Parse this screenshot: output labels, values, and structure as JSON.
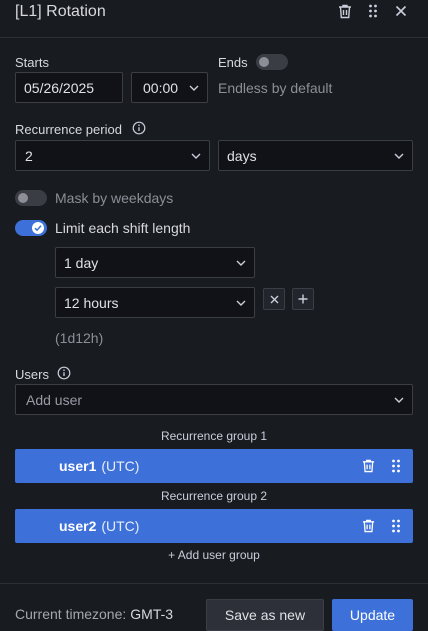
{
  "header": {
    "title": "[L1] Rotation"
  },
  "starts": {
    "label": "Starts",
    "date": "05/26/2025",
    "time": "00:00"
  },
  "ends": {
    "label": "Ends",
    "text": "Endless by default",
    "enabled": false
  },
  "recurrence": {
    "label": "Recurrence period",
    "value": "2",
    "unit": "days"
  },
  "mask": {
    "label": "Mask by weekdays",
    "enabled": false
  },
  "limit": {
    "label": "Limit each shift length",
    "enabled": true,
    "first": "1 day",
    "second": "12 hours",
    "summary": "(1d12h)"
  },
  "users": {
    "label": "Users",
    "placeholder": "Add user",
    "groups": [
      {
        "label": "Recurrence group 1",
        "user": "user1",
        "tz": "(UTC)"
      },
      {
        "label": "Recurrence group 2",
        "user": "user2",
        "tz": "(UTC)"
      }
    ],
    "add_group": "+ Add user group"
  },
  "footer": {
    "tz_label": "Current timezone:",
    "tz_value": "GMT-3",
    "save_new": "Save as new",
    "update": "Update"
  },
  "colors": {
    "accent": "#3d71d9",
    "background": "#181b1f"
  },
  "icons": [
    "trash-icon",
    "drag-handle-icon",
    "close-icon",
    "info-icon",
    "chevron-down-icon",
    "check-icon",
    "plus-icon"
  ]
}
